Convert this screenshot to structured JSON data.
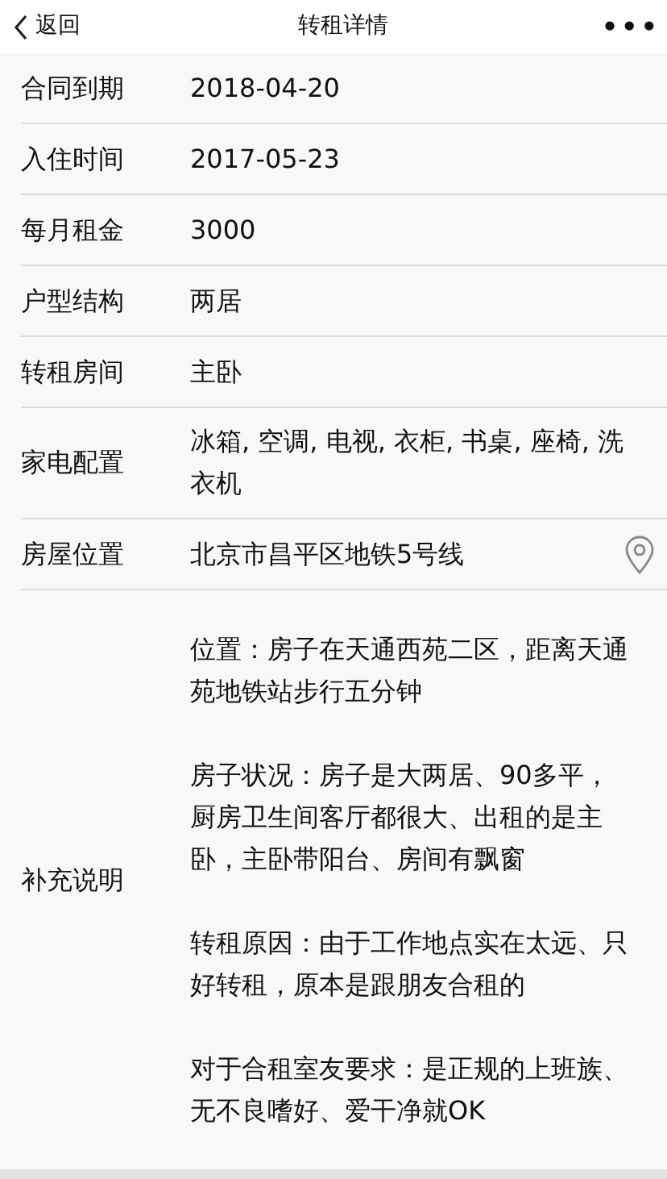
{
  "header": {
    "back": "返回",
    "title": "转租详情",
    "menu": "•••"
  },
  "rows": [
    {
      "kind": "text",
      "label": "合同到期",
      "value": "2018-04-20"
    },
    {
      "kind": "text",
      "label": "入住时间",
      "value": "2017-05-23"
    },
    {
      "kind": "text",
      "label": "每月租金",
      "value": "3000"
    },
    {
      "kind": "text",
      "label": "户型结构",
      "value": "两居"
    },
    {
      "kind": "text",
      "label": "转租房间",
      "value": "主卧"
    },
    {
      "kind": "text",
      "label": "家电配置",
      "value": "冰箱, 空调, 电视, 衣柜, 书桌, 座椅, 洗衣机"
    },
    {
      "kind": "location",
      "label": "房屋位置",
      "value": "北京市昌平区地铁5号线"
    },
    {
      "kind": "note",
      "label": "补充说明",
      "paragraphs": [
        "位置：房子在天通西苑二区，距离天通苑地铁站步行五分钟",
        "房子状况：房子是大两居、90多平，厨房卫生间客厅都很大、出租的是主卧，主卧带阳台、房间有飘窗",
        "转租原因：由于工作地点实在太远、只好转租，原本是跟朋友合租的",
        "对于合租室友要求：是正规的上班族、无不良嗜好、爱干净就OK"
      ]
    }
  ]
}
